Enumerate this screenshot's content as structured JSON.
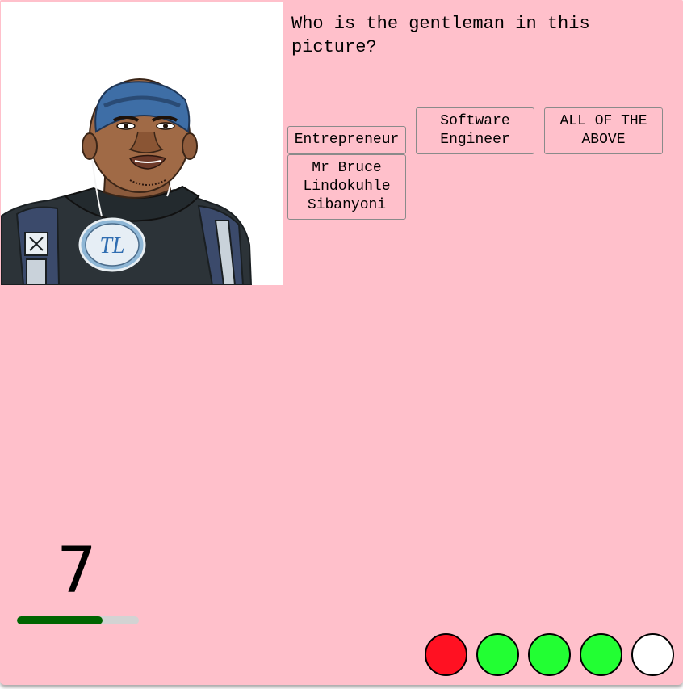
{
  "quiz": {
    "question": "Who is the gentleman in this picture?",
    "answers": [
      "Entrepreneur",
      "Software\nEngineer",
      "ALL OF THE\nABOVE",
      "Mr Bruce\nLindokuhle\nSibanyoni"
    ]
  },
  "picture": {
    "icon": "portrait-illustration",
    "badge_text": "TL"
  },
  "timer": {
    "seconds_left": "7",
    "progress": 0.7
  },
  "results": {
    "statuses": [
      "wrong",
      "correct",
      "correct",
      "correct",
      "pending"
    ],
    "colors": {
      "wrong": "#ff1122",
      "correct": "#22ff33",
      "pending": "#ffffff"
    }
  },
  "colors": {
    "background": "#ffc0cb",
    "timer_fill": "#006400",
    "timer_track": "#d3d3d3"
  }
}
